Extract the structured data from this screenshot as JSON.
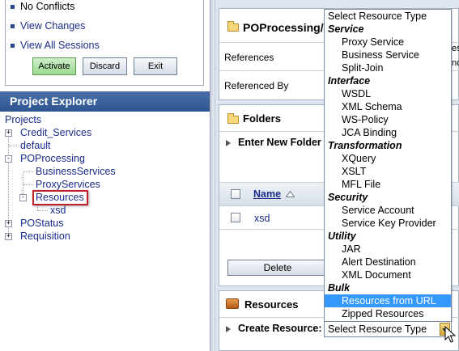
{
  "session": {
    "links": [
      "No Conflicts",
      "View Changes",
      "View All Sessions"
    ],
    "buttons": {
      "activate": "Activate",
      "discard": "Discard",
      "exit": "Exit"
    }
  },
  "project_explorer": {
    "title": "Project Explorer",
    "root": "Projects",
    "items": {
      "credit_services": "Credit_Services",
      "default": "default",
      "poprocessing": "POProcessing",
      "business_services": "BusinessServices",
      "proxy_services": "ProxyServices",
      "resources": "Resources",
      "xsd": "xsd",
      "postatus": "POStatus",
      "requisition": "Requisition"
    },
    "toggles": {
      "collapsed": "+",
      "expanded": "-"
    }
  },
  "main": {
    "project_title": "POProcessing/",
    "references_label": "References",
    "referenced_by_label": "Referenced By",
    "references_partial": "es",
    "referenced_partial": "no",
    "folders_title": "Folders",
    "enter_new_folder": "Enter New Folder",
    "name_column": "Name",
    "folder_row": "xsd",
    "delete_button": "Delete",
    "resources_title": "Resources",
    "create_resource_label": "Create Resource:"
  },
  "resource_dropdown": {
    "selected_value": "Select Resource Type",
    "header": "Select Resource Type",
    "groups": [
      {
        "label": "Service",
        "options": [
          "Proxy Service",
          "Business Service",
          "Split-Join"
        ]
      },
      {
        "label": "Interface",
        "options": [
          "WSDL",
          "XML Schema",
          "WS-Policy",
          "JCA Binding"
        ]
      },
      {
        "label": "Transformation",
        "options": [
          "XQuery",
          "XSLT",
          "MFL File"
        ]
      },
      {
        "label": "Security",
        "options": [
          "Service Account",
          "Service Key Provider"
        ]
      },
      {
        "label": "Utility",
        "options": [
          "JAR",
          "Alert Destination",
          "XML Document"
        ]
      },
      {
        "label": "Bulk",
        "options": [
          "Resources from URL",
          "Zipped Resources"
        ]
      }
    ],
    "highlighted_option": "Resources from URL"
  },
  "icons": {
    "folder": "folder-icon",
    "sort": "sort-ascending-icon",
    "expand": "expand-arrow-icon",
    "cursor": "mouse-pointer-icon"
  },
  "colors": {
    "link": "#1a2c8a",
    "header_bg": "#2e5590",
    "highlight_box": "#c21f2b",
    "selected_option": "#3399ff",
    "activate_button": "#9ad88d"
  }
}
